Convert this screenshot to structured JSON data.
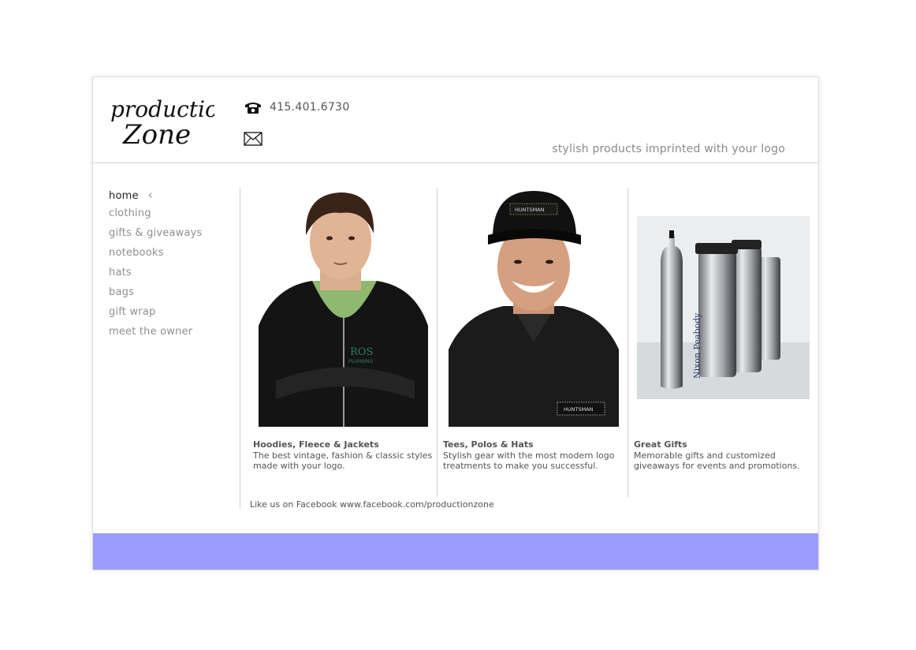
{
  "brand": {
    "logo_text_line1": "production",
    "logo_text_line2": "Zone"
  },
  "header": {
    "phone": "415.401.6730",
    "tagline": "stylish products imprinted with your logo"
  },
  "nav": {
    "items": [
      {
        "label": "home"
      },
      {
        "label": "clothing"
      },
      {
        "label": "gifts & giveaways"
      },
      {
        "label": "notebooks"
      },
      {
        "label": "hats"
      },
      {
        "label": "bags"
      },
      {
        "label": "gift wrap"
      },
      {
        "label": "meet the owner"
      }
    ],
    "active_chevron": "‹"
  },
  "cards": [
    {
      "title": "Hoodies, Fleece & Jackets",
      "desc_line1": "The best vintage, fashion & classic styles",
      "desc_line2": "made with your logo.",
      "image": "man-in-black-hoodie-photo"
    },
    {
      "title": "Tees, Polos & Hats",
      "desc_line1": "Stylish gear with the most modern logo",
      "desc_line2": "treatments to make you successful.",
      "image": "smiling-man-in-cap-and-polo-photo"
    },
    {
      "title": "Great Gifts",
      "desc_line1": "Memorable gifts and customized",
      "desc_line2": "giveaways for events and promotions.",
      "image": "stainless-travel-mugs-photo"
    }
  ],
  "image_labels": {
    "hoodie_logo": "ROS",
    "hoodie_logo_sub": "PLUMBING",
    "cap_logo": "HUNTSMAN",
    "polo_logo": "HUNTSMAN",
    "bottle_text": "Nixon Peabody"
  },
  "facebook": "Like us on Facebook www.facebook.com/productionzone",
  "colors": {
    "footer": "#9c9cff",
    "text": "#555555",
    "nav": "#8f8f8f"
  }
}
